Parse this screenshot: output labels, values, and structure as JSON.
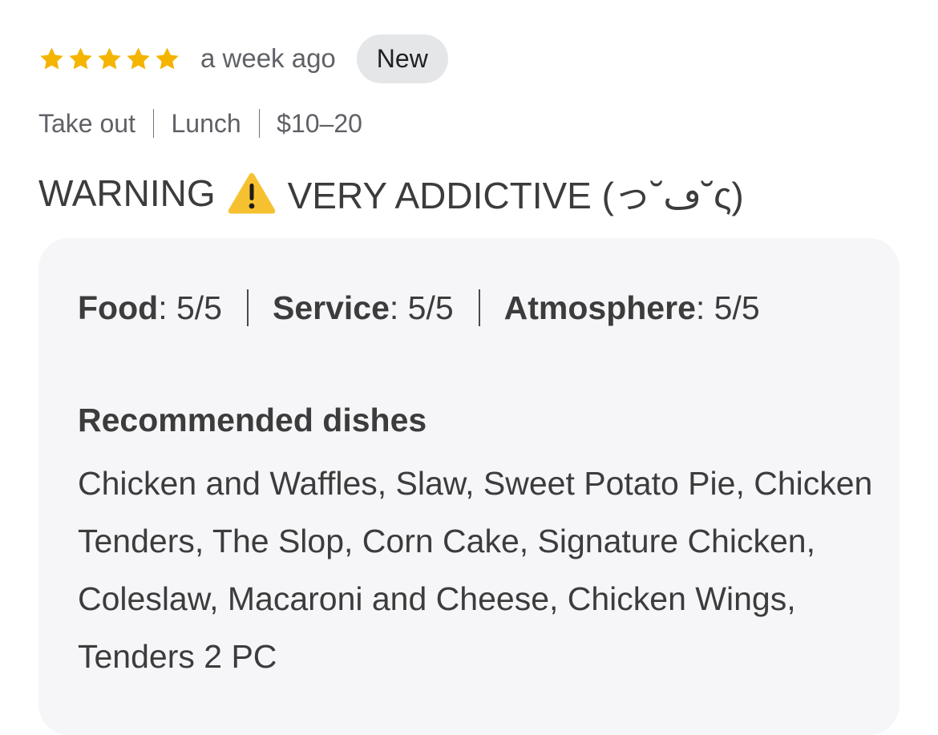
{
  "rating": {
    "stars": 5,
    "max_stars": 5,
    "star_color": "#f4b400",
    "time_ago": "a week ago",
    "badge": "New"
  },
  "meta": {
    "items": [
      "Take out",
      "Lunch",
      "$10–20"
    ]
  },
  "headline": {
    "before_icon": "WARNING",
    "icon": "warning-icon",
    "after_icon": "VERY ADDICTIVE (っ˘ڡ˘ς)"
  },
  "aspects": {
    "food_label": "Food",
    "food_value": ": 5/5",
    "service_label": "Service",
    "service_value": ": 5/5",
    "atmosphere_label": "Atmosphere",
    "atmosphere_value": ": 5/5"
  },
  "recommended": {
    "title": "Recommended dishes",
    "dishes": "Chicken and Waffles, Slaw, Sweet Potato Pie, Chicken Tenders, The Slop, Corn Cake, Signature Chicken, Coleslaw, Macaroni and Cheese, Chicken Wings, Tenders 2 PC"
  }
}
